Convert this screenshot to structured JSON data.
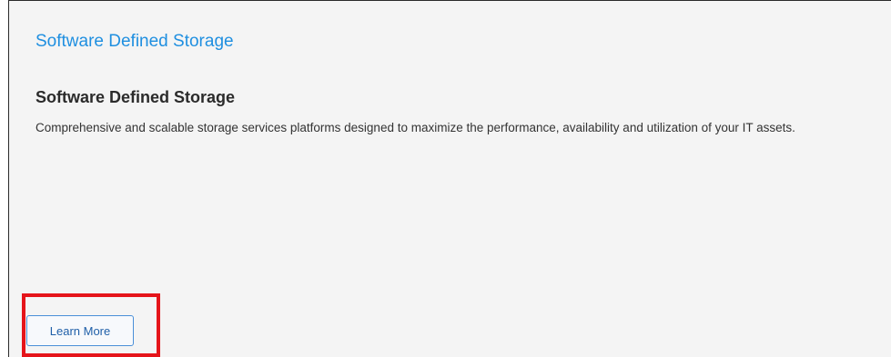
{
  "card": {
    "link_title": "Software Defined Storage",
    "heading": "Software Defined Storage",
    "description": "Comprehensive and scalable storage services platforms designed to maximize the performance, availability and utilization of your IT assets.",
    "button_label": "Learn More"
  },
  "colors": {
    "link": "#1f8fe0",
    "highlight": "#e5141a",
    "button_border": "#4a8fd8"
  }
}
